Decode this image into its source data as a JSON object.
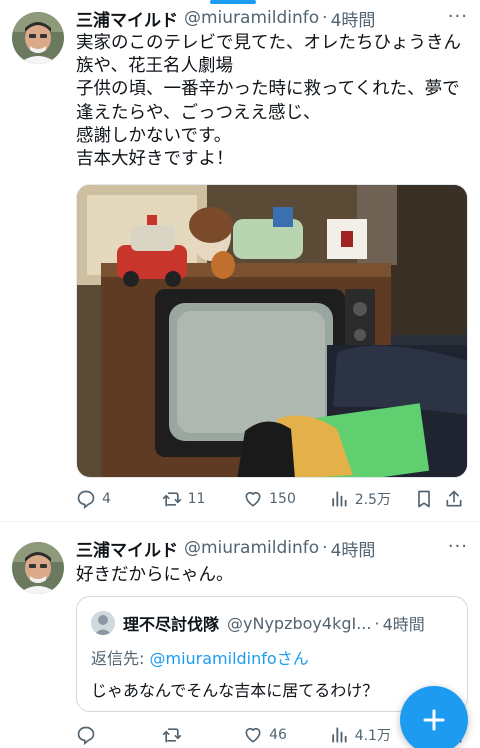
{
  "tweets": [
    {
      "author": {
        "name": "三浦マイルド",
        "handle": "@miuramildinfo",
        "separator": "·",
        "time": "4時間"
      },
      "more_label": "···",
      "text_lines": [
        "実家のこのテレビで見てた、オレたちひょうきん",
        "族や、花王名人劇場",
        "子供の頃、一番辛かった時に救ってくれた、夢で",
        "逢えたらや、ごっつええ感じ、",
        "感謝しかないです。",
        "吉本大好きですよ！"
      ],
      "media": {
        "description_icon": "retro-tv-photo"
      },
      "actions": {
        "reply_count": "4",
        "retweet_count": "11",
        "like_count": "150",
        "view_count": "2.5万"
      }
    },
    {
      "author": {
        "name": "三浦マイルド",
        "handle": "@miuramildinfo",
        "separator": "·",
        "time": "4時間"
      },
      "more_label": "···",
      "text_lines": [
        "好きだからにゃん。"
      ],
      "quote": {
        "author": {
          "name": "理不尽討伐隊",
          "handle": "@yNypzboy4kgI...",
          "separator": "·",
          "time": "4時間"
        },
        "reply_prefix": "返信先: ",
        "reply_target": "@miuramildinfo",
        "reply_suffix": "さん",
        "text": "じゃあなんでそんな吉本に居てるわけ？"
      },
      "actions": {
        "reply_count": "",
        "retweet_count": "",
        "like_count": "46",
        "view_count": "4.1万"
      }
    }
  ],
  "fab": {
    "icon": "compose-plus-icon"
  },
  "colors": {
    "accent": "#1d9bf0",
    "text": "#0f1419",
    "muted": "#536471",
    "border": "#cfd9de"
  }
}
